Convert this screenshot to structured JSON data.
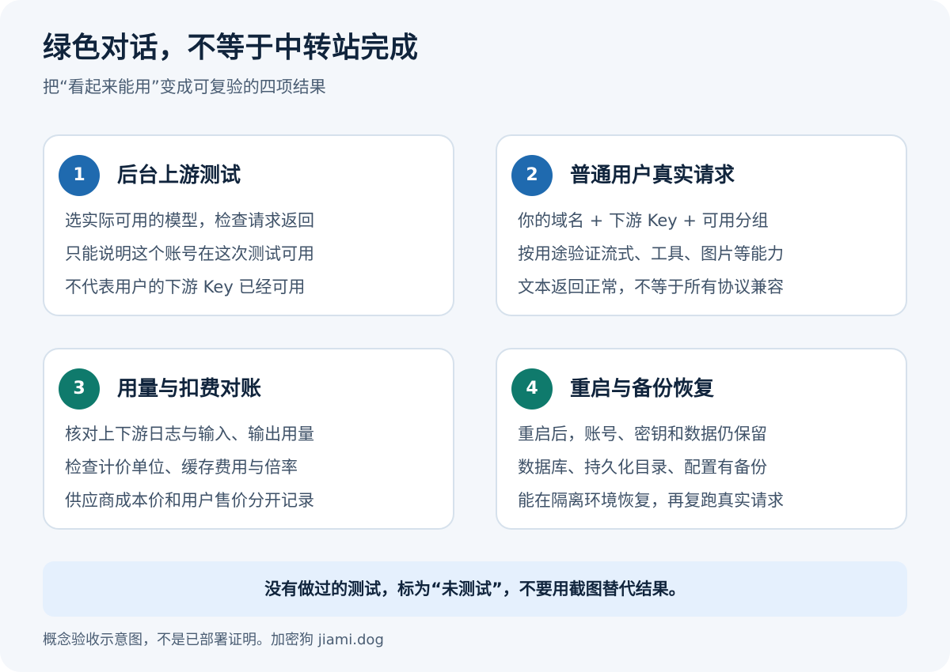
{
  "header": {
    "title": "绿色对话，不等于中转站完成",
    "subtitle": "把“看起来能用”变成可复验的四项结果"
  },
  "cards": [
    {
      "number": "1",
      "title": "后台上游测试",
      "lines": [
        "选实际可用的模型，检查请求返回",
        "只能说明这个账号在这次测试可用",
        "不代表用户的下游 Key 已经可用"
      ]
    },
    {
      "number": "2",
      "title": "普通用户真实请求",
      "lines": [
        "你的域名 + 下游 Key + 可用分组",
        "按用途验证流式、工具、图片等能力",
        "文本返回正常，不等于所有协议兼容"
      ]
    },
    {
      "number": "3",
      "title": "用量与扣费对账",
      "lines": [
        "核对上下游日志与输入、输出用量",
        "检查计价单位、缓存费用与倍率",
        "供应商成本价和用户售价分开记录"
      ]
    },
    {
      "number": "4",
      "title": "重启与备份恢复",
      "lines": [
        "重启后，账号、密钥和数据仍保留",
        "数据库、持久化目录、配置有备份",
        "能在隔离环境恢复，再复跑真实请求"
      ]
    }
  ],
  "banner": {
    "text": "没有做过的测试，标为“未测试”，不要用截图替代结果。"
  },
  "footer": {
    "text": "概念验收示意图，不是已部署证明。加密狗 jiami.dog"
  },
  "colors": {
    "badge_blue": "#1f6aaf",
    "badge_green": "#0f7a6c",
    "background": "#f4f7fb",
    "banner_bg": "#e5f0fd",
    "card_border": "#d6e1ec"
  }
}
